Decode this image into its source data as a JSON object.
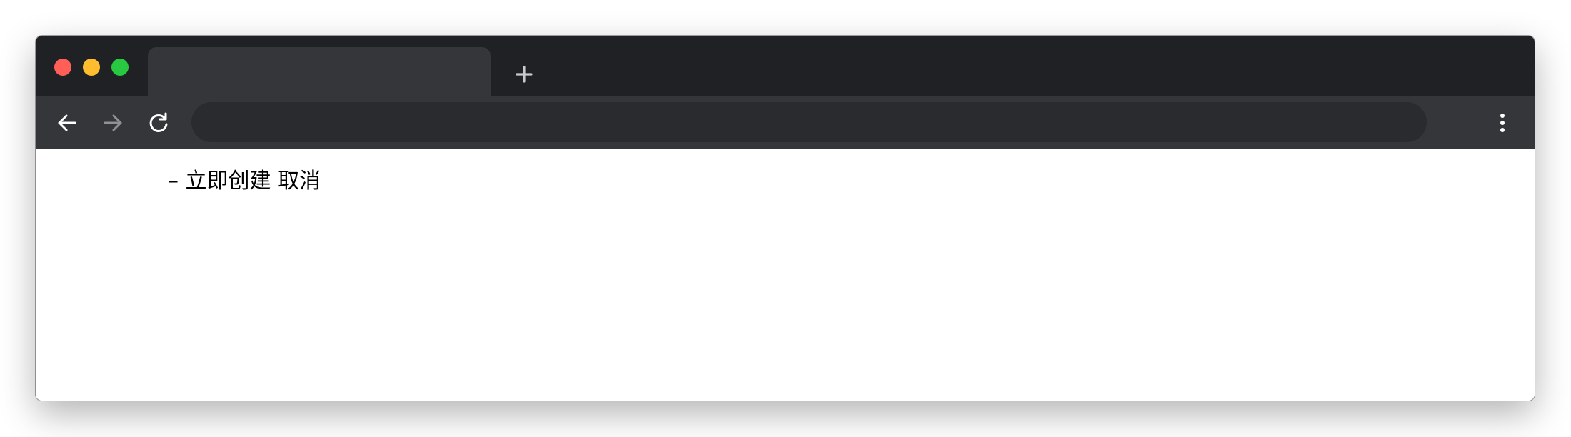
{
  "browser": {
    "tab": {
      "title": ""
    },
    "address_bar": {
      "value": "",
      "placeholder": ""
    },
    "icons": {
      "close": "close-traffic-light",
      "minimize": "minimize-traffic-light",
      "maximize": "maximize-traffic-light",
      "new_tab": "plus-icon",
      "back": "arrow-left-icon",
      "forward": "arrow-right-icon",
      "reload": "reload-icon",
      "menu": "vertical-dots-icon"
    },
    "colors": {
      "tabstrip": "#202124",
      "toolbar": "#35363a",
      "omnibox": "#292b2e",
      "close": "#ff5f57",
      "minimize": "#febc2e",
      "maximize": "#28c840"
    }
  },
  "page": {
    "dash": "–",
    "create_now": "立即创建",
    "cancel": "取消"
  }
}
